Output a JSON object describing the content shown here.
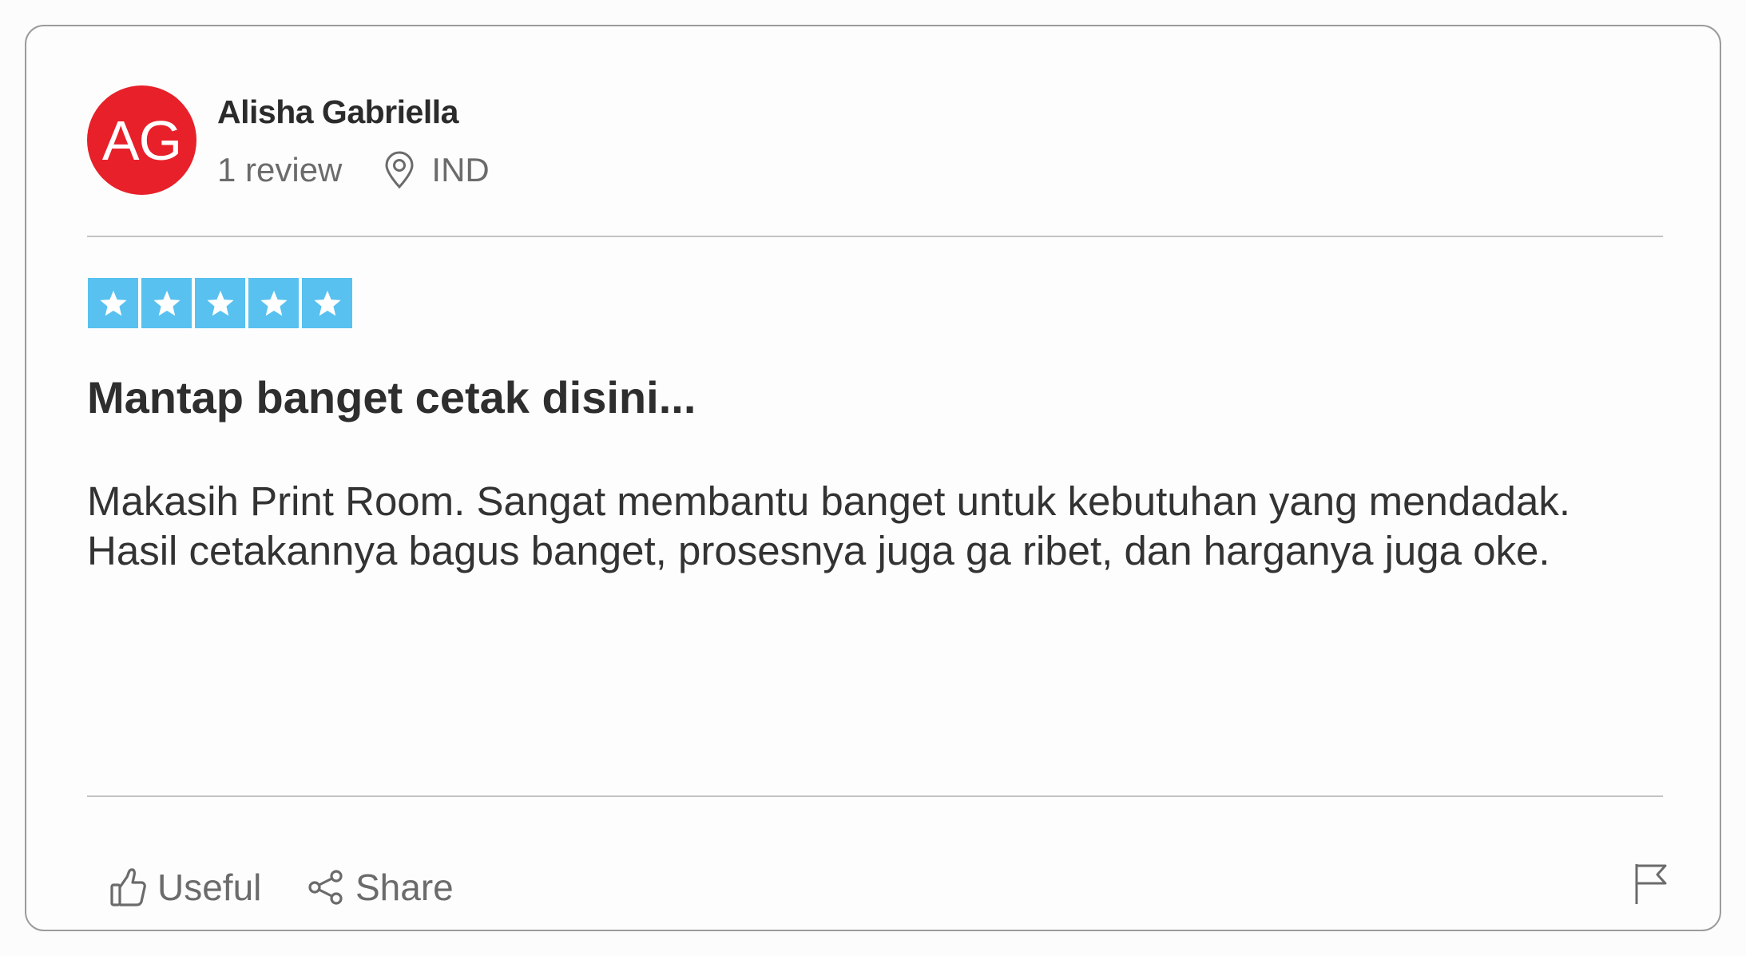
{
  "reviewer": {
    "initials": "AG",
    "name": "Alisha Gabriella",
    "review_count": "1 review",
    "country": "IND",
    "avatar_color": "#e8202a"
  },
  "rating": {
    "stars": 5,
    "max_stars": 5,
    "color": "#58c1f0"
  },
  "review": {
    "title": "Mantap banget cetak disini...",
    "body_lines": [
      "Makasih Print Room. Sangat membantu banget untuk kebutuhan yang mendadak.",
      "Hasil cetakannya bagus banget, prosesnya juga ga ribet, dan harganya juga oke."
    ]
  },
  "actions": {
    "useful_label": "Useful",
    "share_label": "Share",
    "useful_icon": "thumbs-up-icon",
    "share_icon": "share-icon",
    "report_icon": "flag-icon"
  }
}
